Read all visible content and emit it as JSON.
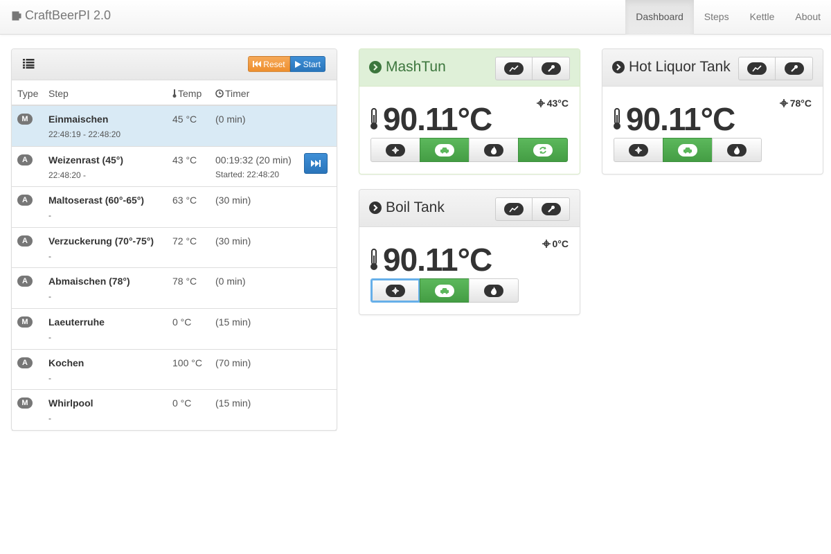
{
  "app": {
    "title": "CraftBeerPI 2.0"
  },
  "nav": [
    {
      "label": "Dashboard"
    },
    {
      "label": "Steps"
    },
    {
      "label": "Kettle"
    },
    {
      "label": "About"
    }
  ],
  "steps_panel": {
    "reset_label": "Reset",
    "start_label": "Start",
    "columns": {
      "type": "Type",
      "step": "Step",
      "temp": "Temp",
      "timer": "Timer"
    },
    "rows": [
      {
        "type": "M",
        "name": "Einmaischen",
        "sub": "22:48:19 - 22:48:20",
        "temp": "45 °C",
        "timer": "(0 min)",
        "timer_sub": ""
      },
      {
        "type": "A",
        "name": "Weizenrast (45°)",
        "sub": "22:48:20 -",
        "temp": "43 °C",
        "timer": "00:19:32 (20 min)",
        "timer_sub": "Started: 22:48:20"
      },
      {
        "type": "A",
        "name": "Maltoserast (60°-65°)",
        "sub": "-",
        "temp": "63 °C",
        "timer": "(30 min)",
        "timer_sub": ""
      },
      {
        "type": "A",
        "name": "Verzuckerung (70°-75°)",
        "sub": "-",
        "temp": "72 °C",
        "timer": "(30 min)",
        "timer_sub": ""
      },
      {
        "type": "A",
        "name": "Abmaischen (78°)",
        "sub": "-",
        "temp": "78 °C",
        "timer": "(0 min)",
        "timer_sub": ""
      },
      {
        "type": "M",
        "name": "Laeuterruhe",
        "sub": "-",
        "temp": "0 °C",
        "timer": "(15 min)",
        "timer_sub": ""
      },
      {
        "type": "A",
        "name": "Kochen",
        "sub": "-",
        "temp": "100 °C",
        "timer": "(70 min)",
        "timer_sub": ""
      },
      {
        "type": "M",
        "name": "Whirlpool",
        "sub": "-",
        "temp": "0 °C",
        "timer": "(15 min)",
        "timer_sub": ""
      }
    ]
  },
  "kettles": {
    "mash": {
      "name": "MashTun",
      "temp": "90.11°C",
      "target": "43°C"
    },
    "hlt": {
      "name": "Hot Liquor Tank",
      "temp": "90.11°C",
      "target": "78°C"
    },
    "boil": {
      "name": "Boil Tank",
      "temp": "90.11°C",
      "target": "0°C"
    }
  },
  "colors": {
    "success": "#5cb85c",
    "primary": "#2a75bb",
    "warning": "#f0ad4e",
    "active_row": "#d9eaf5"
  }
}
